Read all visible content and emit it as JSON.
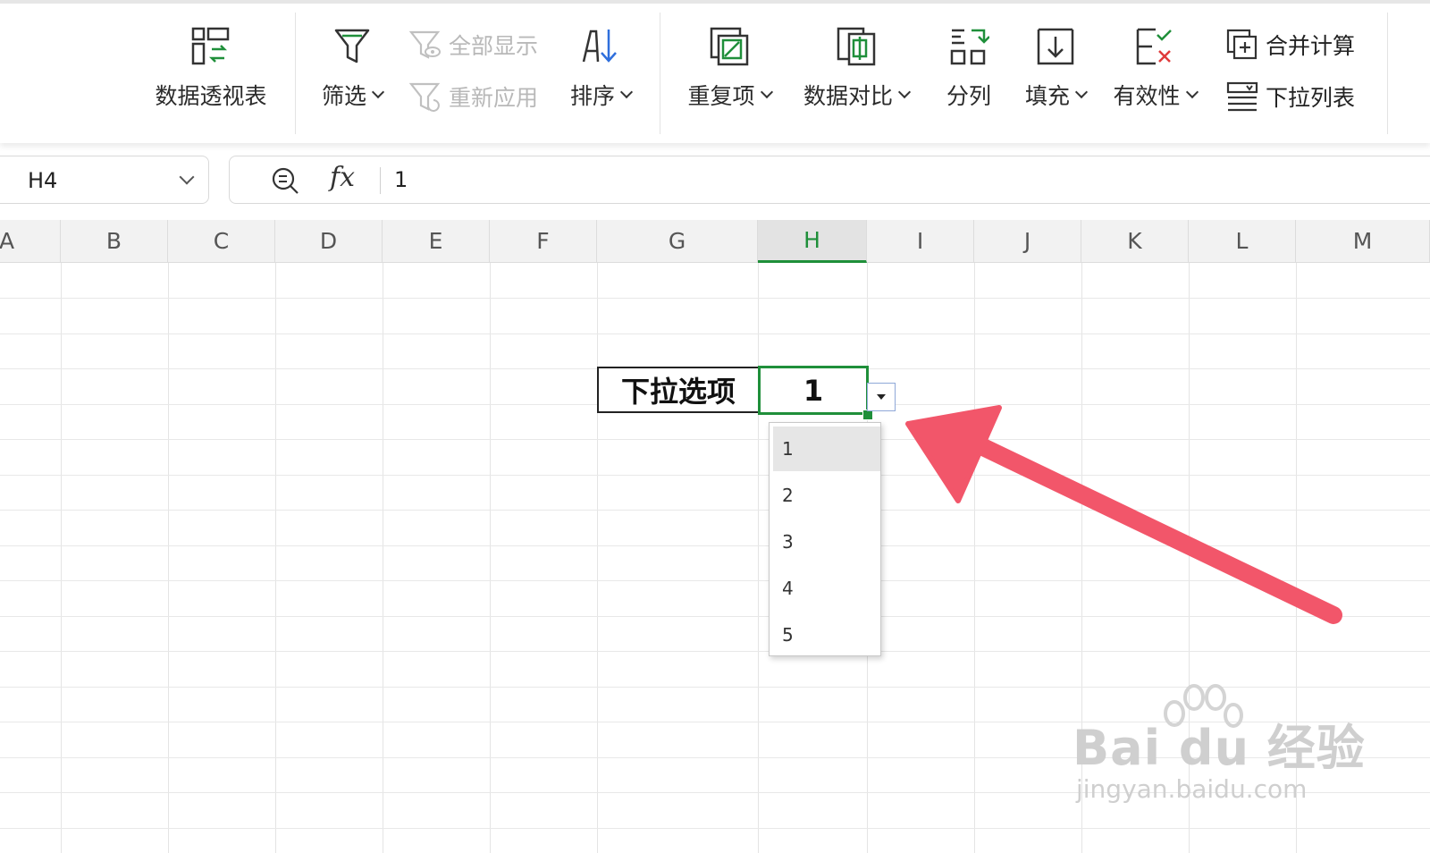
{
  "ribbon": {
    "pivot_table": "数据透视表",
    "filter": "筛选",
    "show_all": "全部显示",
    "reapply": "重新应用",
    "sort": "排序",
    "duplicates": "重复项",
    "data_compare": "数据对比",
    "split_column": "分列",
    "fill": "填充",
    "validation": "有效性",
    "consolidate": "合并计算",
    "dropdown_list": "下拉列表"
  },
  "formula_bar": {
    "name_box": "H4",
    "fx_label": "fx",
    "content": "1"
  },
  "columns": [
    "A",
    "B",
    "C",
    "D",
    "E",
    "F",
    "G",
    "H",
    "I",
    "J",
    "K",
    "L",
    "M"
  ],
  "active_column": "H",
  "sheet": {
    "label_cell_text": "下拉选项",
    "selected_cell_value": "1"
  },
  "dropdown": {
    "options": [
      "1",
      "2",
      "3",
      "4",
      "5"
    ],
    "highlighted": "1"
  },
  "watermark": {
    "line1": "Bai du 经验",
    "line2": "jingyan.baidu.com"
  },
  "colors": {
    "accent_green": "#1f8f3a",
    "arrow_red": "#f2566a"
  }
}
